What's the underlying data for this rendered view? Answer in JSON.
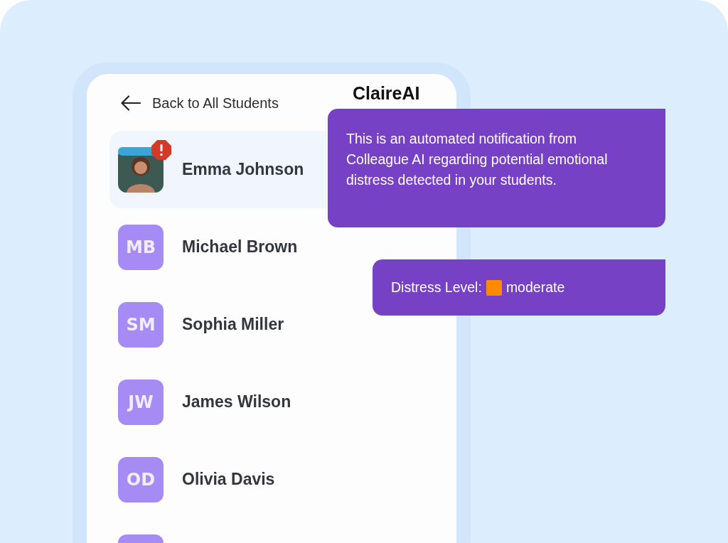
{
  "header": {
    "back_label": "Back to All Students",
    "title": "ClaireAI"
  },
  "students": [
    {
      "name": "Emma Johnson",
      "alert": true,
      "selected": true
    },
    {
      "name": "Michael Brown",
      "initials": "MB",
      "alert": false,
      "selected": false
    },
    {
      "name": "Sophia Miller",
      "initials": "SM",
      "alert": false,
      "selected": false
    },
    {
      "name": "James Wilson",
      "initials": "JW",
      "alert": false,
      "selected": false
    },
    {
      "name": "Olivia Davis",
      "initials": "OD",
      "alert": false,
      "selected": false
    }
  ],
  "messages": [
    {
      "kind": "text",
      "text": "This is an automated notification from Colleague AI regarding potential emotional distress detected in your students."
    },
    {
      "kind": "level",
      "label": "Distress Level:",
      "value": "moderate",
      "color": "#ff8a00"
    }
  ]
}
